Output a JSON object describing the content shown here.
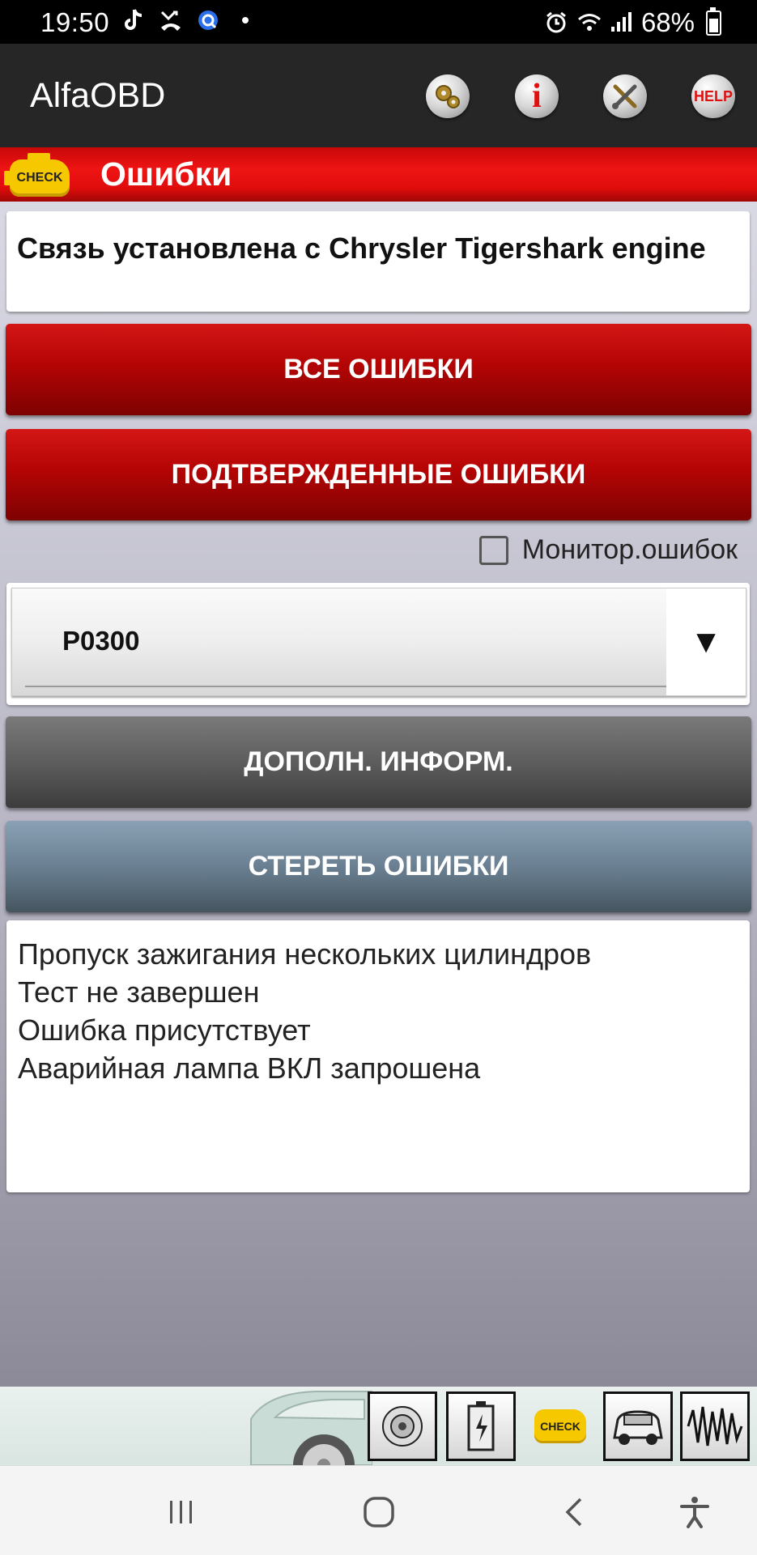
{
  "status_bar": {
    "time": "19:50",
    "battery": "68%",
    "icons_left": [
      "tiktok-icon",
      "missed-call-icon",
      "app-notification-icon",
      "dot-icon"
    ],
    "icons_right": [
      "alarm-icon",
      "wifi-icon",
      "signal-icon",
      "battery-icon"
    ]
  },
  "app_bar": {
    "title": "AlfaOBD",
    "actions": [
      "gears-icon",
      "info-icon",
      "tools-icon",
      "help-icon"
    ],
    "help_label": "HELP",
    "info_label": "i"
  },
  "section": {
    "badge": "CHECK",
    "title": "Ошибки"
  },
  "connection": {
    "message": " Связь установлена с Chrysler Tigershark engine"
  },
  "buttons": {
    "all_errors": "ВСЕ ОШИБКИ",
    "confirmed_errors": "ПОДТВЕРЖДЕННЫЕ ОШИБКИ",
    "more_info": "ДОПОЛН. ИНФОРМ.",
    "clear_errors": "СТЕРЕТЬ ОШИБКИ"
  },
  "monitor": {
    "label": "Монитор.ошибок",
    "checked": false
  },
  "error_select": {
    "selected": "P0300",
    "arrow": "▼"
  },
  "error_details": [
    "Пропуск зажигания нескольких цилиндров",
    "Тест не завершен",
    "Ошибка присутствует",
    "Аварийная лампа ВКЛ запрошена"
  ],
  "bottom_strip": {
    "tiles": [
      "speaker-icon",
      "battery-charge-icon",
      "check-engine-icon",
      "car-service-icon",
      "waveform-icon"
    ],
    "check_label": "CHECK"
  },
  "nav_bar": {
    "buttons": [
      "recents-icon",
      "home-icon",
      "back-icon",
      "accessibility-icon"
    ]
  },
  "colors": {
    "accent_red": "#e00c0c",
    "check_yellow": "#f5c800",
    "app_bar": "#262626"
  }
}
